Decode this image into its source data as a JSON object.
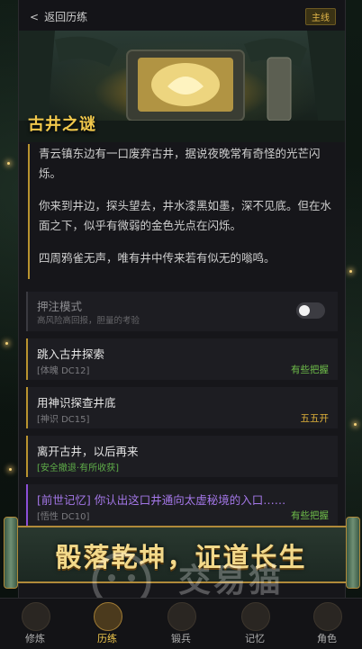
{
  "header": {
    "back_label": "返回历练",
    "tag": "主线"
  },
  "scene": {
    "title": "古井之谜"
  },
  "story": {
    "paragraphs": [
      "青云镇东边有一口废弃古井，据说夜晚常有奇怪的光芒闪烁。",
      "你来到井边，探头望去，井水漆黑如墨，深不见底。但在水面之下，似乎有微弱的金色光点在闪烁。",
      "四周鸦雀无声，唯有井中传来若有似无的嗡鸣。"
    ]
  },
  "mode": {
    "title": "押注模式",
    "subtitle": "高风险高回报，胆量的考验",
    "enabled": false
  },
  "choices": [
    {
      "title": "跳入古井探索",
      "check": "[体魄 DC12]",
      "hint": "有些把握",
      "hint_color": "#6fbf4a"
    },
    {
      "title": "用神识探查井底",
      "check": "[神识 DC15]",
      "hint": "五五开",
      "hint_color": "#e0b23a"
    },
    {
      "title": "离开古井，以后再来",
      "check": "[安全撤退·有所收获]",
      "check_color": "#5fae49"
    },
    {
      "title": "[前世记忆] 你认出这口井通向太虚秘境的入口……",
      "check": "[悟性 DC10]",
      "hint": "有些把握",
      "hint_color": "#6fbf4a"
    }
  ],
  "banner": {
    "text": "骰落乾坤，证道长生"
  },
  "watermark": {
    "text": "交易猫"
  },
  "tabs": [
    {
      "label": "修炼"
    },
    {
      "label": "历练"
    },
    {
      "label": "锻兵"
    },
    {
      "label": "记忆"
    },
    {
      "label": "角色"
    }
  ],
  "colors": {
    "accent_gold": "#f2c94c",
    "border_gold": "#b8932f",
    "purple": "#8c4fd8"
  }
}
